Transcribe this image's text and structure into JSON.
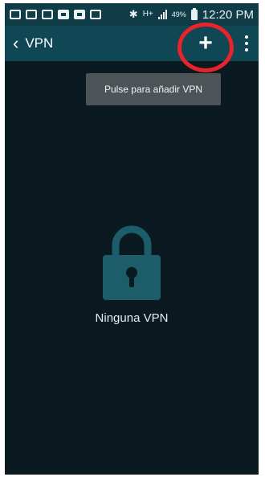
{
  "status_bar": {
    "notification_icons": [
      "gallery-icon",
      "email-icon",
      "email-icon",
      "file-icon",
      "photo-icon",
      "shop-icon"
    ],
    "network": "H+",
    "battery": "49%",
    "time": "12:20 PM"
  },
  "action_bar": {
    "back_label": "VPN",
    "add_icon": "+"
  },
  "tooltip": {
    "text": "Pulse para añadir VPN"
  },
  "empty_state": {
    "icon": "lock-icon",
    "label": "Ninguna VPN"
  },
  "colors": {
    "status_bar_bg": "#103c47",
    "action_bar_bg": "#0f4754",
    "screen_bg": "#0a1a20",
    "lock_color": "#1d5d69",
    "highlight_ring": "#e8242a",
    "tooltip_bg": "#4d5457"
  }
}
